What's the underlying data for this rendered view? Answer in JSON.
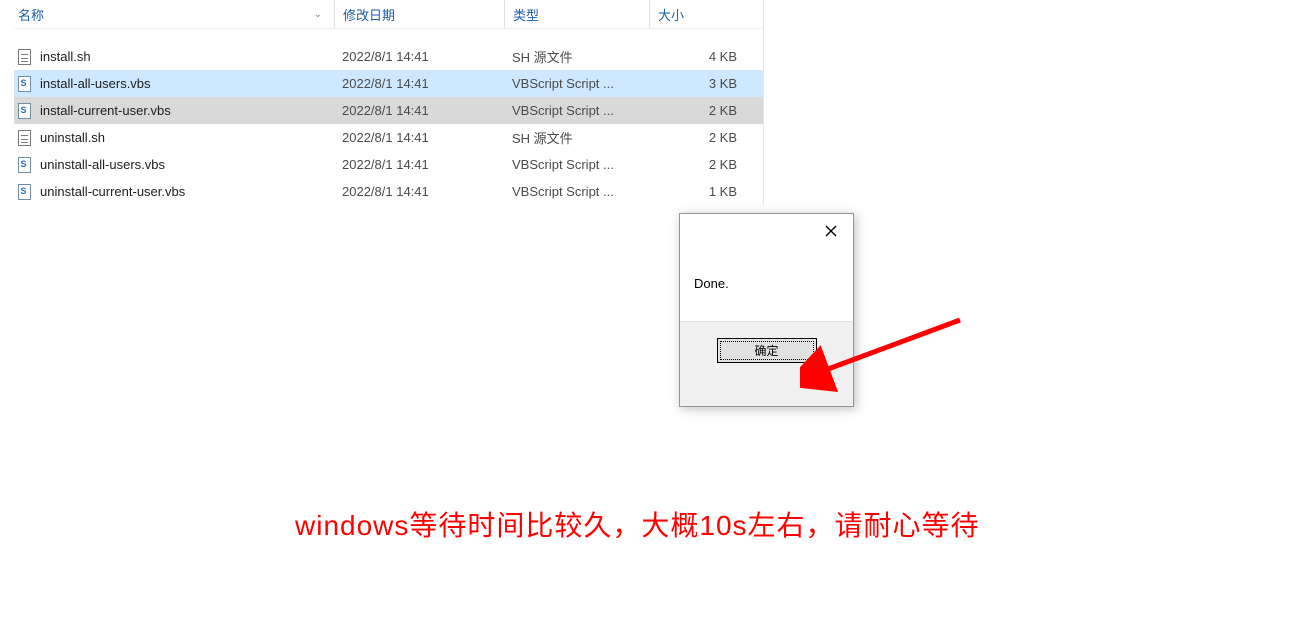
{
  "columns": {
    "name": "名称",
    "date": "修改日期",
    "type": "类型",
    "size": "大小"
  },
  "files": [
    {
      "icon": "sh",
      "name": "install.sh",
      "date": "2022/8/1 14:41",
      "type": "SH 源文件",
      "size": "4 KB",
      "state": ""
    },
    {
      "icon": "vbs",
      "name": "install-all-users.vbs",
      "date": "2022/8/1 14:41",
      "type": "VBScript Script ...",
      "size": "3 KB",
      "state": "selected"
    },
    {
      "icon": "vbs",
      "name": "install-current-user.vbs",
      "date": "2022/8/1 14:41",
      "type": "VBScript Script ...",
      "size": "2 KB",
      "state": "highlighted"
    },
    {
      "icon": "sh",
      "name": "uninstall.sh",
      "date": "2022/8/1 14:41",
      "type": "SH 源文件",
      "size": "2 KB",
      "state": ""
    },
    {
      "icon": "vbs",
      "name": "uninstall-all-users.vbs",
      "date": "2022/8/1 14:41",
      "type": "VBScript Script ...",
      "size": "2 KB",
      "state": ""
    },
    {
      "icon": "vbs",
      "name": "uninstall-current-user.vbs",
      "date": "2022/8/1 14:41",
      "type": "VBScript Script ...",
      "size": "1 KB",
      "state": ""
    }
  ],
  "dialog": {
    "message": "Done.",
    "ok_label": "确定"
  },
  "caption": "windows等待时间比较久，大概10s左右，请耐心等待"
}
